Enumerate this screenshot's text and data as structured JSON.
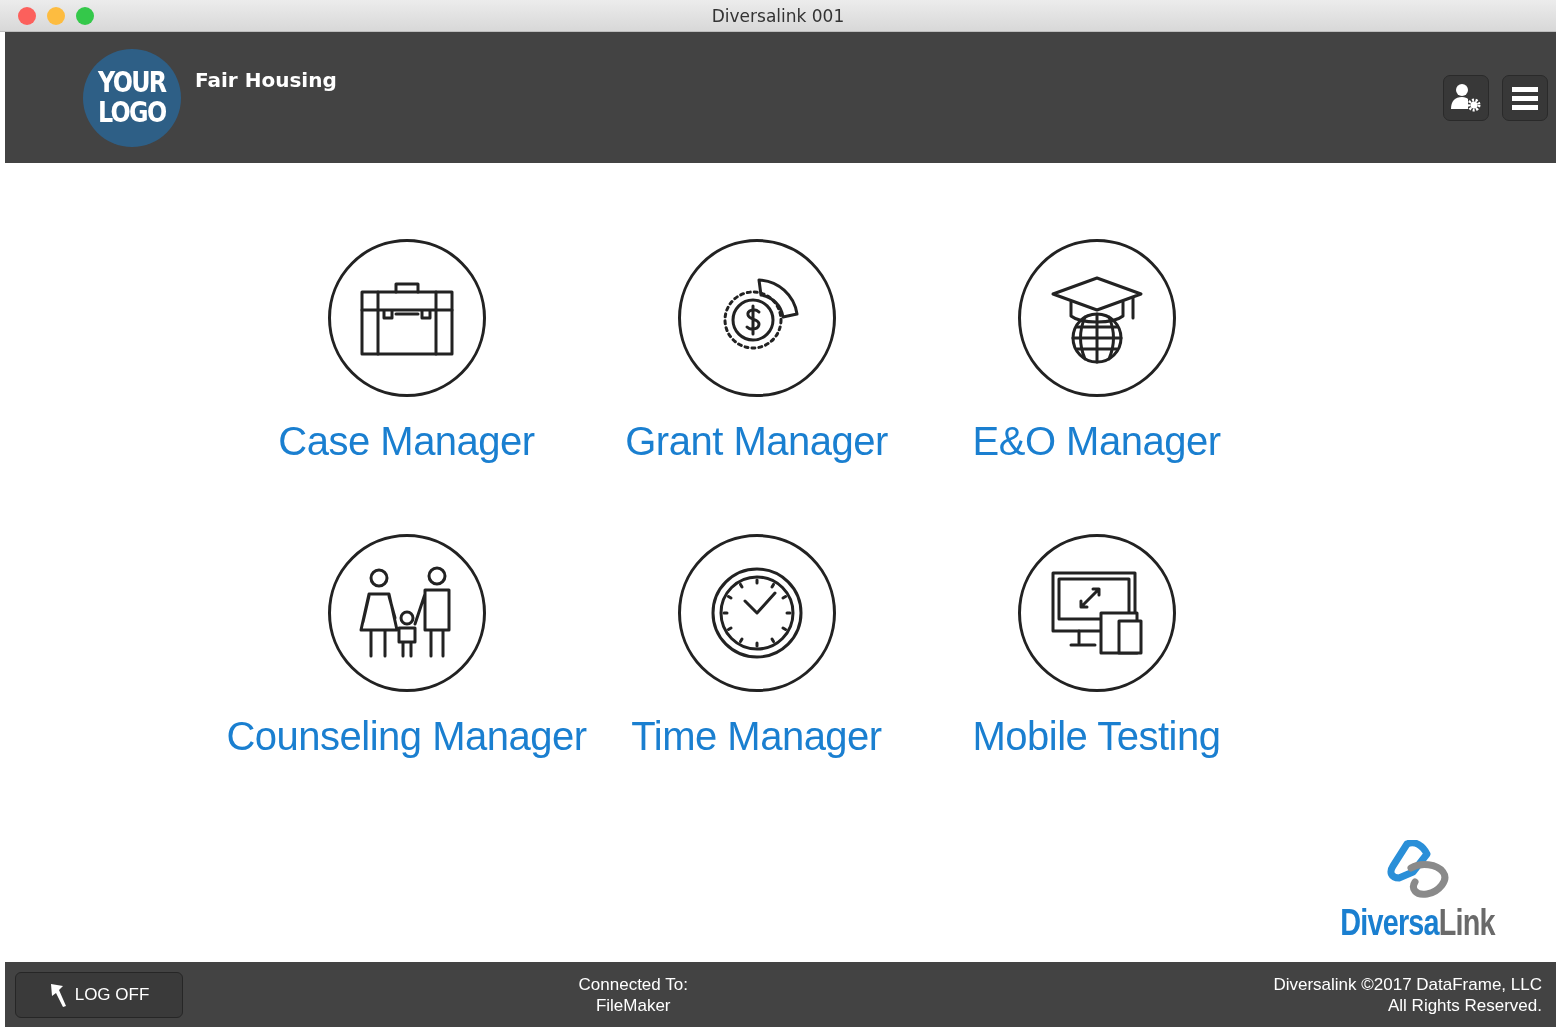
{
  "window": {
    "title": "Diversalink 001"
  },
  "header": {
    "logo_lines": [
      "YOUR",
      "LOGO"
    ],
    "title": "Fair Housing"
  },
  "modules": [
    {
      "kind": "briefcase",
      "label": "Case Manager"
    },
    {
      "kind": "grant",
      "label": "Grant Manager"
    },
    {
      "kind": "education",
      "label": "E&O Manager"
    },
    {
      "kind": "family",
      "label": "Counseling Manager"
    },
    {
      "kind": "clock",
      "label": "Time Manager"
    },
    {
      "kind": "devices",
      "label": "Mobile Testing"
    }
  ],
  "brand": {
    "name_primary": "Diversa",
    "name_secondary": "Link"
  },
  "footer": {
    "logoff": "LOG OFF",
    "connection": [
      "Connected To:",
      "FileMaker"
    ],
    "copyright": [
      "Diversalink ©2017 DataFrame, LLC",
      "All Rights Reserved."
    ]
  }
}
